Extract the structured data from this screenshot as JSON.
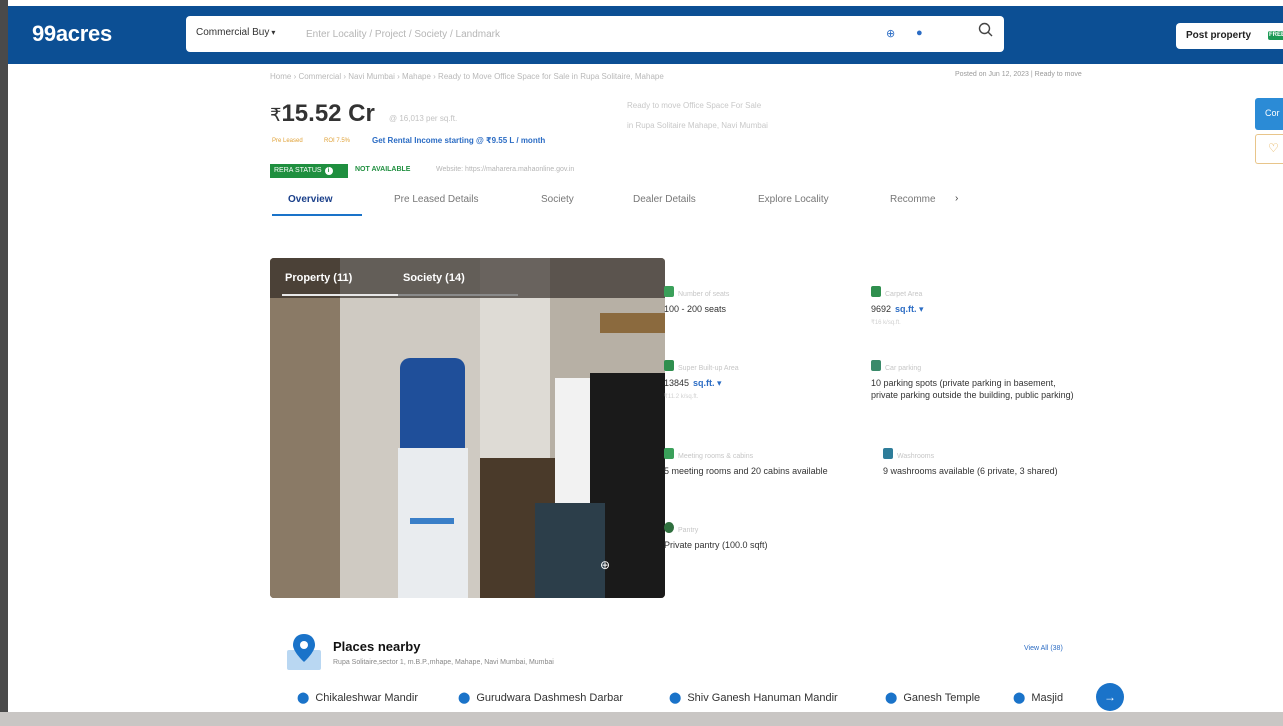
{
  "header": {
    "logo": "99acres",
    "search_category": "Commercial Buy",
    "search_placeholder": "Enter Locality / Project / Society / Landmark",
    "post_property_label": "Post property",
    "free_badge": "FREE"
  },
  "side_buttons": {
    "contact_label": "Cor"
  },
  "listing": {
    "breadcrumb": "Home › Commercial › Navi Mumbai › Mahape › Ready to Move Office Space for Sale in Rupa Solitaire, Mahape",
    "posted": "Posted on Jun 12, 2023  |  Ready to move",
    "price_symbol": "₹",
    "price": "15.52 Cr",
    "per_sqft": "@ 16,013 per sq.ft.",
    "headline_1": "Ready to move Office Space For Sale",
    "headline_2": "in Rupa Solitaire Mahape, Navi Mumbai",
    "tag_preleased": "Pre Leased",
    "tag_roi": "ROI 7.5%",
    "rental_text": "Get Rental Income starting @ ₹9.55 L / month",
    "rera_label": "RERA STATUS",
    "rera_value": "NOT AVAILABLE",
    "website": "Website: https://maharera.mahaonline.gov.in"
  },
  "tabs": [
    {
      "label": "Overview",
      "active": true
    },
    {
      "label": "Pre Leased Details",
      "active": false
    },
    {
      "label": "Society",
      "active": false
    },
    {
      "label": "Dealer Details",
      "active": false
    },
    {
      "label": "Explore Locality",
      "active": false
    },
    {
      "label": "Recomme",
      "active": false
    }
  ],
  "photos": {
    "tab_property": "Property (11)",
    "tab_society": "Society (14)"
  },
  "features": {
    "seats": {
      "label": "Number of seats",
      "value": "100 - 200 seats",
      "icon": "chair-icon",
      "color": "#3aa05a"
    },
    "carpet": {
      "label": "Carpet Area",
      "value": "9692",
      "unit": "sq.ft.",
      "sub": "₹16 k/sq.ft.",
      "icon": "area-icon",
      "color": "#2f8f4e"
    },
    "super_builtup": {
      "label": "Super Built-up Area",
      "value": "13845",
      "unit": "sq.ft.",
      "sub": "₹11.2 k/sq.ft.",
      "icon": "area-icon",
      "color": "#2f8f4e"
    },
    "parking": {
      "label": "Car parking",
      "value": "10 parking spots (private parking in basement, private parking outside the building, public parking)",
      "icon": "car-icon",
      "color": "#3a8a6a"
    },
    "meeting": {
      "label": "Meeting rooms & cabins",
      "value": "5 meeting rooms and 20 cabins available",
      "icon": "meeting-icon",
      "color": "#3aa05a"
    },
    "washrooms": {
      "label": "Washrooms",
      "value": "9 washrooms available (6 private, 3 shared)",
      "icon": "washroom-icon",
      "color": "#2e7d9a"
    },
    "pantry": {
      "label": "Pantry",
      "value": "Private pantry (100.0 sqft)",
      "icon": "pantry-icon",
      "color": "#2f6f3e"
    }
  },
  "places": {
    "title": "Places nearby",
    "address": "Rupa Solitaire,sector 1, m.B.P.,mhape, Mahape, Navi Mumbai, Mumbai",
    "view_all": "View All (38)",
    "items": [
      "Chikaleshwar Mandir",
      "Gurudwara Dashmesh Darbar",
      "Shiv Ganesh Hanuman Mandir",
      "Ganesh Temple",
      "Masjid"
    ]
  }
}
